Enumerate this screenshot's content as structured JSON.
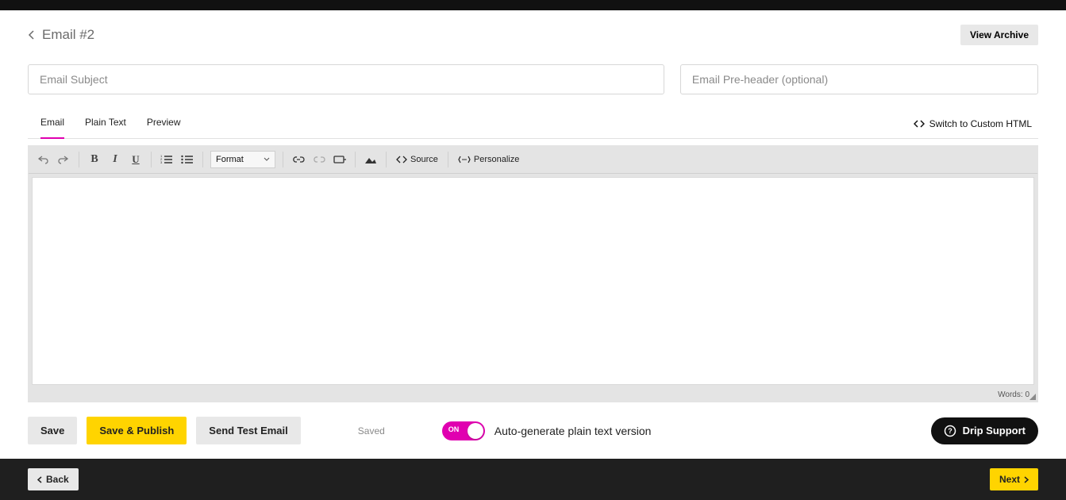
{
  "header": {
    "back_title": "Email #2",
    "view_archive": "View Archive"
  },
  "fields": {
    "subject_placeholder": "Email Subject",
    "preheader_placeholder": "Email Pre-header (optional)"
  },
  "tabs": {
    "email": "Email",
    "plain": "Plain Text",
    "preview": "Preview",
    "switch_html": "Switch to Custom HTML"
  },
  "toolbar": {
    "format": "Format",
    "source": "Source",
    "personalize": "Personalize"
  },
  "editor": {
    "words_label": "Words: ",
    "words_count": "0"
  },
  "actions": {
    "save": "Save",
    "save_publish": "Save & Publish",
    "send_test": "Send Test Email",
    "saved": "Saved",
    "toggle_on": "ON",
    "toggle_label": "Auto-generate plain text version",
    "support": "Drip Support"
  },
  "footer": {
    "back": "Back",
    "next": "Next"
  }
}
